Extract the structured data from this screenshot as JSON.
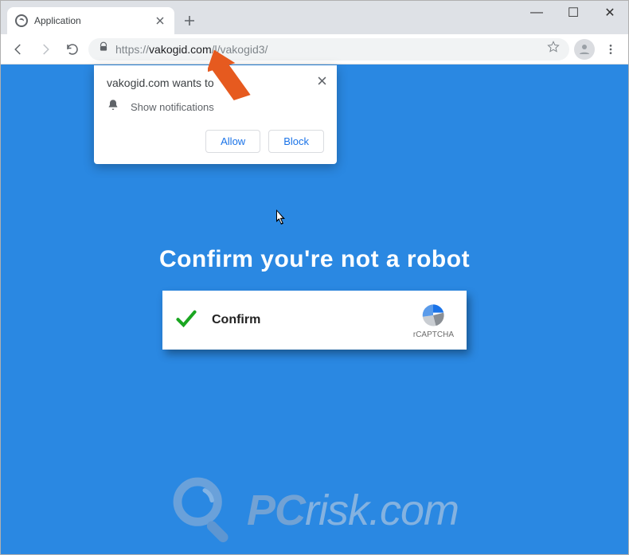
{
  "window": {
    "tab_title": "Application",
    "minimize_glyph": "—",
    "maximize_glyph": "☐",
    "close_glyph": "✕"
  },
  "address": {
    "protocol": "https://",
    "host": "vakogid.com",
    "path": "/l/vakogid3/"
  },
  "prompt": {
    "title": "vakogid.com wants to",
    "permission": "Show notifications",
    "allow": "Allow",
    "block": "Block"
  },
  "page": {
    "headline": "Confirm you're not a robot",
    "confirm_label": "Confirm",
    "rcaptcha_label": "rCAPTCHA"
  },
  "watermark": {
    "brand_bold": "PC",
    "brand_rest": "risk.com"
  }
}
